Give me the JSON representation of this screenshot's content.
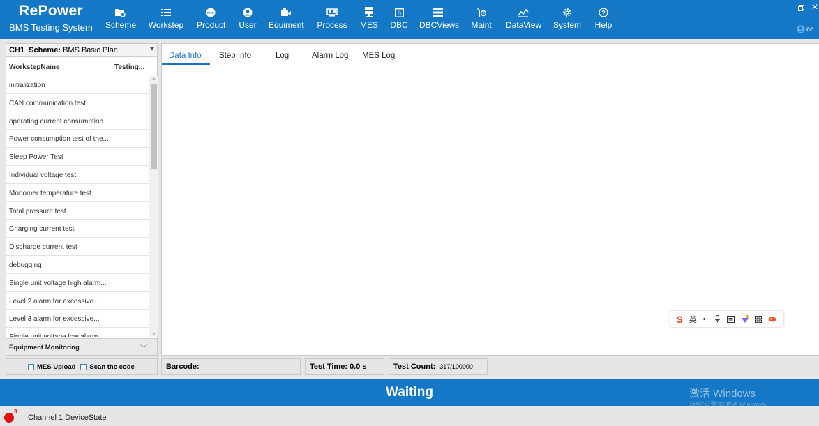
{
  "app": {
    "name": "RePower",
    "subtitle": "BMS Testing System"
  },
  "colors": {
    "primary": "#1478c6",
    "tab_active": "#1a73c8",
    "led": "#e01010"
  },
  "toolbar": [
    {
      "label": "Scheme",
      "icon": "scheme-icon"
    },
    {
      "label": "Workstep",
      "icon": "list-icon"
    },
    {
      "label": "Product",
      "icon": "product-icon"
    },
    {
      "label": "User",
      "icon": "user-icon"
    },
    {
      "label": "Equiment",
      "icon": "camera-icon"
    },
    {
      "label": "Process",
      "icon": "process-icon"
    },
    {
      "label": "MES",
      "icon": "server-icon"
    },
    {
      "label": "DBC",
      "icon": "dbc-icon"
    },
    {
      "label": "DBCViews",
      "icon": "table-icon"
    },
    {
      "label": "Maint",
      "icon": "wrench-icon"
    },
    {
      "label": "DataView",
      "icon": "chart-icon"
    },
    {
      "label": "System",
      "icon": "gear-icon"
    },
    {
      "label": "Help",
      "icon": "help-icon"
    }
  ],
  "user": {
    "name": "cc"
  },
  "left": {
    "channel": "CH1",
    "scheme_label": "Scheme:",
    "scheme_value": "BMS Basic Plan",
    "col_name": "WorkstepName",
    "col_status": "Testing...",
    "items": [
      "initialization",
      "CAN communication test",
      "operating current consumption",
      "Power consumption test of the...",
      "Sleep Power Test",
      "Individual voltage test",
      "Monomer temperature test",
      "Total pressure test",
      "Charging current test",
      "Discharge current test",
      "debugging",
      "Single unit voltage high alarm...",
      "Level 2 alarm for excessive...",
      "Level 3 alarm for excessive...",
      "Single unit voltage low alarm..."
    ],
    "equipment": "Equipment Monitoring"
  },
  "tabs": [
    "Data Info",
    "Step Info",
    "Log",
    "Alarm Log",
    "MES Log"
  ],
  "ime": {
    "lang": "英"
  },
  "bottom": {
    "mes_upload": "MES Upload",
    "scan_code": "Scan the code",
    "barcode_label": "Barcode:",
    "test_time_label": "Test Time:",
    "test_time_value": "0.0 s",
    "test_count_label": "Test Count:",
    "test_count_value": "317/100000"
  },
  "status": {
    "text": "Waiting",
    "watermark1": "激活 Windows",
    "watermark2": "转到\"设置\"以激活 Windows。"
  },
  "footer": {
    "badge": "3",
    "text": "Channel 1 DeviceState"
  }
}
